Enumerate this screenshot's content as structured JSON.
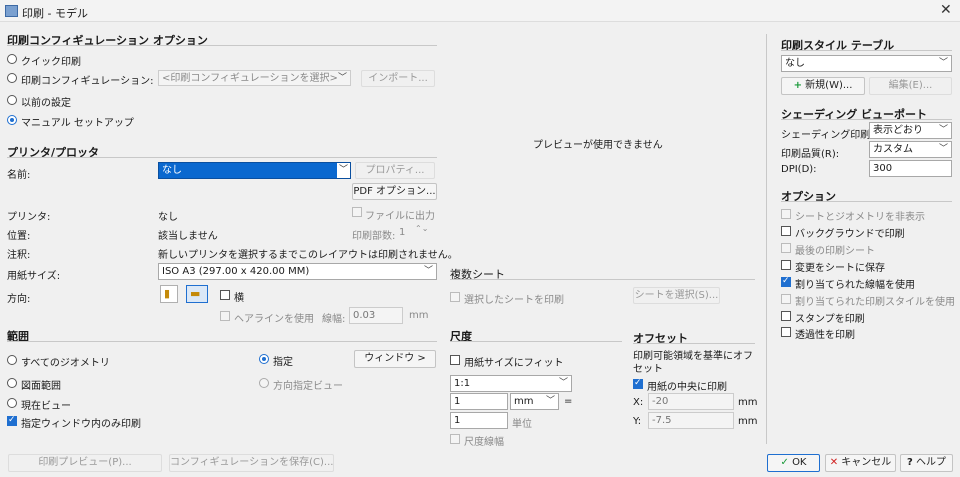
{
  "window": {
    "title": "印刷 - モデル",
    "close_glyph": "✕"
  },
  "page_setup": {
    "header": "印刷コンフィギュレーション オプション",
    "quick_print": "クイック印刷",
    "config_label": "印刷コンフィギュレーション:",
    "config_value": "<印刷コンフィギュレーションを選択>",
    "import_button": "インポート...",
    "prev_settings": "以前の設定",
    "manual_setup": "マニュアル セットアップ"
  },
  "printer": {
    "header": "プリンタ/プロッタ",
    "name_label": "名前:",
    "name_value": "なし",
    "properties_button": "プロパティ...",
    "pdf_options_button": "PDF オプション...",
    "printer_label": "プリンタ:",
    "printer_value": "なし",
    "print_to_file": "ファイルに出力",
    "location_label": "位置:",
    "location_value": "該当しません",
    "copies_label": "印刷部数:",
    "copies_value": "1",
    "note_label": "注釈:",
    "note_value": "新しいプリンタを選択するまでこのレイアウトは印刷されません。",
    "paper_size_label": "用紙サイズ:",
    "paper_size_value": "ISO A3 (297.00 x 420.00 MM)",
    "orientation_label": "方向:",
    "landscape": "横",
    "hairline_label": "ヘアラインを使用",
    "thickness_label": "線幅:",
    "thickness_value": "0.03",
    "thickness_unit": "mm"
  },
  "preview": {
    "message": "プレビューが使用できません"
  },
  "multiple_sheets": {
    "header": "複数シート",
    "print_selected": "選択したシートを印刷",
    "select_sheets_button": "シートを選択(S)..."
  },
  "area": {
    "header": "範囲",
    "all_geometry": "すべてのジオメトリ",
    "specify": "指定",
    "window_button": "ウィンドウ >",
    "drawing_limits": "図面範囲",
    "print_direction": "方向指定ビュー",
    "current_view": "現在ビュー",
    "window_only": "指定ウィンドウ内のみ印刷"
  },
  "scale": {
    "header": "尺度",
    "fit_paper": "用紙サイズにフィット",
    "ratio": "1:1",
    "value1": "1",
    "unit1": "mm",
    "equals": "=",
    "value2": "1",
    "unit2": "単位",
    "scale_lineweights": "尺度線幅"
  },
  "offset": {
    "header": "オフセット",
    "description": "印刷可能領域を基準にオフセット",
    "center": "用紙の中央に印刷",
    "x_label": "X:",
    "x_value": "-20",
    "y_label": "Y:",
    "y_value": "-7.5",
    "unit": "mm"
  },
  "style_table": {
    "header": "印刷スタイル テーブル",
    "value": "なし",
    "new_button": "新規(W)...",
    "new_icon": "+",
    "edit_button": "編集(E)..."
  },
  "shaded": {
    "header": "シェーディング ビューポート",
    "shade_label": "シェーディング印刷",
    "shade_value": "表示どおり",
    "quality_label": "印刷品質(R):",
    "quality_value": "カスタム",
    "dpi_label": "DPI(D):",
    "dpi_value": "300"
  },
  "options": {
    "header": "オプション",
    "sheet_geometry": "シートとジオメトリを非表示",
    "background": "バックグラウンドで印刷",
    "last_sheet": "最後の印刷シート",
    "save_changes": "変更をシートに保存",
    "lineweights": "割り当てられた線幅を使用",
    "styles": "割り当てられた印刷スタイルを使用",
    "stamp": "スタンプを印刷",
    "transparency": "透過性を印刷"
  },
  "footer": {
    "preview_button": "印刷プレビュー(P)...",
    "save_config_button": "コンフィギュレーションを保存(C)...",
    "ok_button": "OK",
    "ok_icon": "✓",
    "cancel_button": "キャンセル",
    "cancel_icon": "✕",
    "help_button": "ヘルプ",
    "help_icon": "?"
  }
}
